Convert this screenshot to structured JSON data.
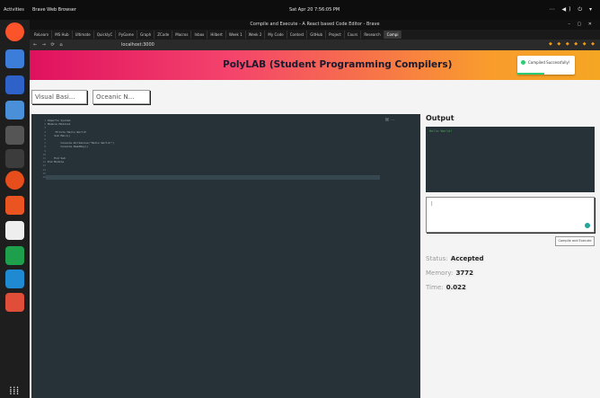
{
  "system": {
    "activities": "Activities",
    "app_name": "Brave Web Browser",
    "clock": "Sat Apr 20  7:56:05 PM",
    "tray": "⋯ ◀) ⏻ ▾"
  },
  "browser": {
    "window_title": "Compile and Execute - A React based Code Editor - Brave",
    "window_controls": "– ▢ ✕",
    "tabs": [
      "ReLearn",
      "MS Hub",
      "Ultimate",
      "QuicklyC",
      "PyGame",
      "Graph",
      "ZCode",
      "Macros",
      "Inbox",
      "Hilbert",
      "Week 1",
      "Week 2",
      "My Code",
      "Contest",
      "GitHub",
      "Project",
      "Cours",
      "Research",
      "Compi"
    ],
    "active_tab_index": 18,
    "nav_icons": "← → ⟳ ⌂",
    "url": "localhost:3000",
    "extensions": "◆ ◆ ◆ ◆ ◆ ◆"
  },
  "header": {
    "title": "PolyLAB (Student Programming Compilers)",
    "toast_text": "Compiled Successfully!"
  },
  "controls": {
    "language": "Visual Basi...",
    "theme": "Oceanic N..."
  },
  "editor": {
    "line_numbers": [
      "1",
      "2",
      "3",
      "4",
      "5",
      "6",
      "7",
      "8",
      "9",
      "10",
      "11",
      "12",
      "13",
      "14",
      "15",
      "16"
    ],
    "code": [
      "Imports System",
      "Module Module1",
      "",
      "    'Prints Hello World!",
      "    Sub Main()",
      "",
      "        Console.WriteLine(\"Hello World!\")",
      "        Console.ReadKey()",
      "",
      "",
      "    End Sub",
      "End Module",
      "",
      "",
      "",
      ""
    ],
    "controls": "⌘ ⋯"
  },
  "output": {
    "label": "Output",
    "text": "Hello World!",
    "input_placeholder": "|",
    "run_button": "Compile and Execute",
    "status_label": "Status:",
    "status_value": "Accepted",
    "memory_label": "Memory:",
    "memory_value": "3772",
    "time_label": "Time:",
    "time_value": "0.022"
  },
  "colors": {
    "header_start": "#e0115f",
    "header_end": "#f5a623",
    "editor_bg": "#263238",
    "output_text": "#4caf50",
    "success": "#2ecc71"
  }
}
